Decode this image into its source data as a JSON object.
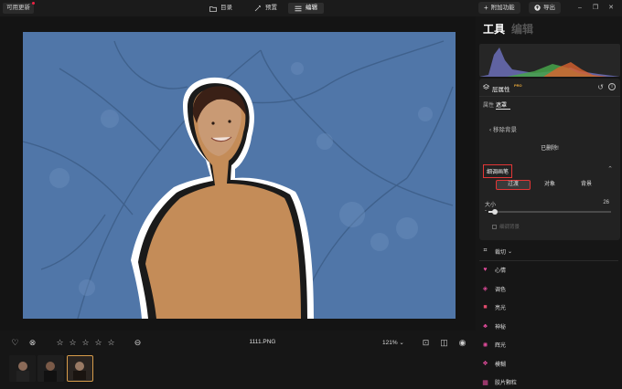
{
  "topbar": {
    "update_label": "可用更新",
    "tabs": [
      {
        "label": "目录",
        "icon": "folder-icon"
      },
      {
        "label": "预置",
        "icon": "magic-wand-icon"
      },
      {
        "label": "编辑",
        "icon": "sliders-icon"
      }
    ],
    "addon_label": "附加功能",
    "export_label": "导出"
  },
  "canvas": {
    "filename": "1111.PNG",
    "zoom": "121%",
    "rating_stars": 5
  },
  "panel": {
    "title": "工具",
    "subtitle": "编辑",
    "layer": {
      "name": "层属性",
      "badge": "PRO",
      "tabs": [
        "属性",
        "遮罩"
      ],
      "back_label": "移除背景",
      "status": "已删除!",
      "brush_title": "细调画笔",
      "modes": [
        "过渡",
        "对象",
        "背景"
      ],
      "size_label": "大小",
      "size_value": "26",
      "size_fraction": 0.05,
      "checkbox_label": "细调背景"
    },
    "tools": [
      {
        "label": "裁切",
        "icon": "crop-icon",
        "color": "#dddddd"
      },
      {
        "label": "心情",
        "icon": "mood-icon",
        "color": "#e04b9b"
      },
      {
        "label": "调色",
        "icon": "palette-icon",
        "color": "#e04b9b"
      },
      {
        "label": "亮光",
        "icon": "light-icon",
        "color": "#e04b6b"
      },
      {
        "label": "神秘",
        "icon": "mystery-icon",
        "color": "#e04b9b"
      },
      {
        "label": "辉光",
        "icon": "glow-icon",
        "color": "#e04b9b"
      },
      {
        "label": "模糊",
        "icon": "blur-icon",
        "color": "#e04b9b"
      },
      {
        "label": "胶片颗粒",
        "icon": "grain-icon",
        "color": "#e04b9b"
      }
    ]
  },
  "colors": {
    "accent_red": "#e23636",
    "mask_blue": "#5076a8",
    "subject_fill": "#c48c58",
    "selection_gold": "#d89c4a"
  }
}
